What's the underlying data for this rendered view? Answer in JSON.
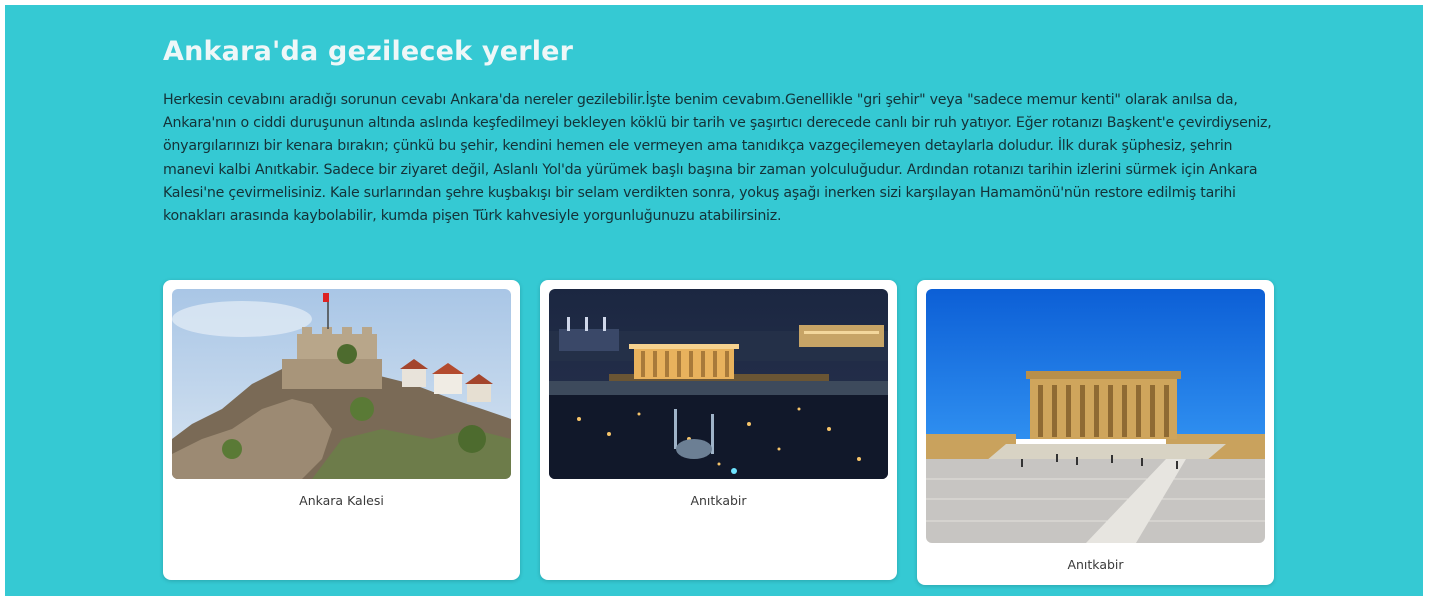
{
  "page": {
    "title": "Ankara'da gezilecek yerler",
    "intro": "Herkesin cevabını aradığı sorunun cevabı Ankara'da nereler gezilebilir.İşte benim cevabım.Genellikle \"gri şehir\" veya \"sadece memur kenti\" olarak anılsa da, Ankara'nın o ciddi duruşunun altında aslında keşfedilmeyi bekleyen köklü bir tarih ve şaşırtıcı derecede canlı bir ruh yatıyor. Eğer rotanızı Başkent'e çevirdiyseniz, önyargılarınızı bir kenara bırakın; çünkü bu şehir, kendini hemen ele vermeyen ama tanıdıkça vazgeçilemeyen detaylarla doludur. İlk durak şüphesiz, şehrin manevi kalbi Anıtkabir. Sadece bir ziyaret değil, Aslanlı Yol'da yürümek başlı başına bir zaman yolculuğudur. Ardından rotanızı tarihin izlerini sürmek için Ankara Kalesi'ne çevirmelisiniz. Kale surlarından şehre kuşbakışı bir selam verdikten sonra, yokuş aşağı inerken sizi karşılayan Hamamönü'nün restore edilmiş tarihi konakları arasında kaybolabilir, kumda pişen Türk kahvesiyle yorgunluğunuzu atabilirsiniz."
  },
  "cards": [
    {
      "caption": "Ankara Kalesi",
      "image": "castle-photo"
    },
    {
      "caption": "Anıtkabir",
      "image": "night-mausoleum-photo"
    },
    {
      "caption": "Anıtkabir",
      "image": "day-mausoleum-photo"
    }
  ],
  "colors": {
    "background": "#35c9d3",
    "title": "#eef7f8",
    "body_text": "#143238",
    "card": "#ffffff"
  }
}
